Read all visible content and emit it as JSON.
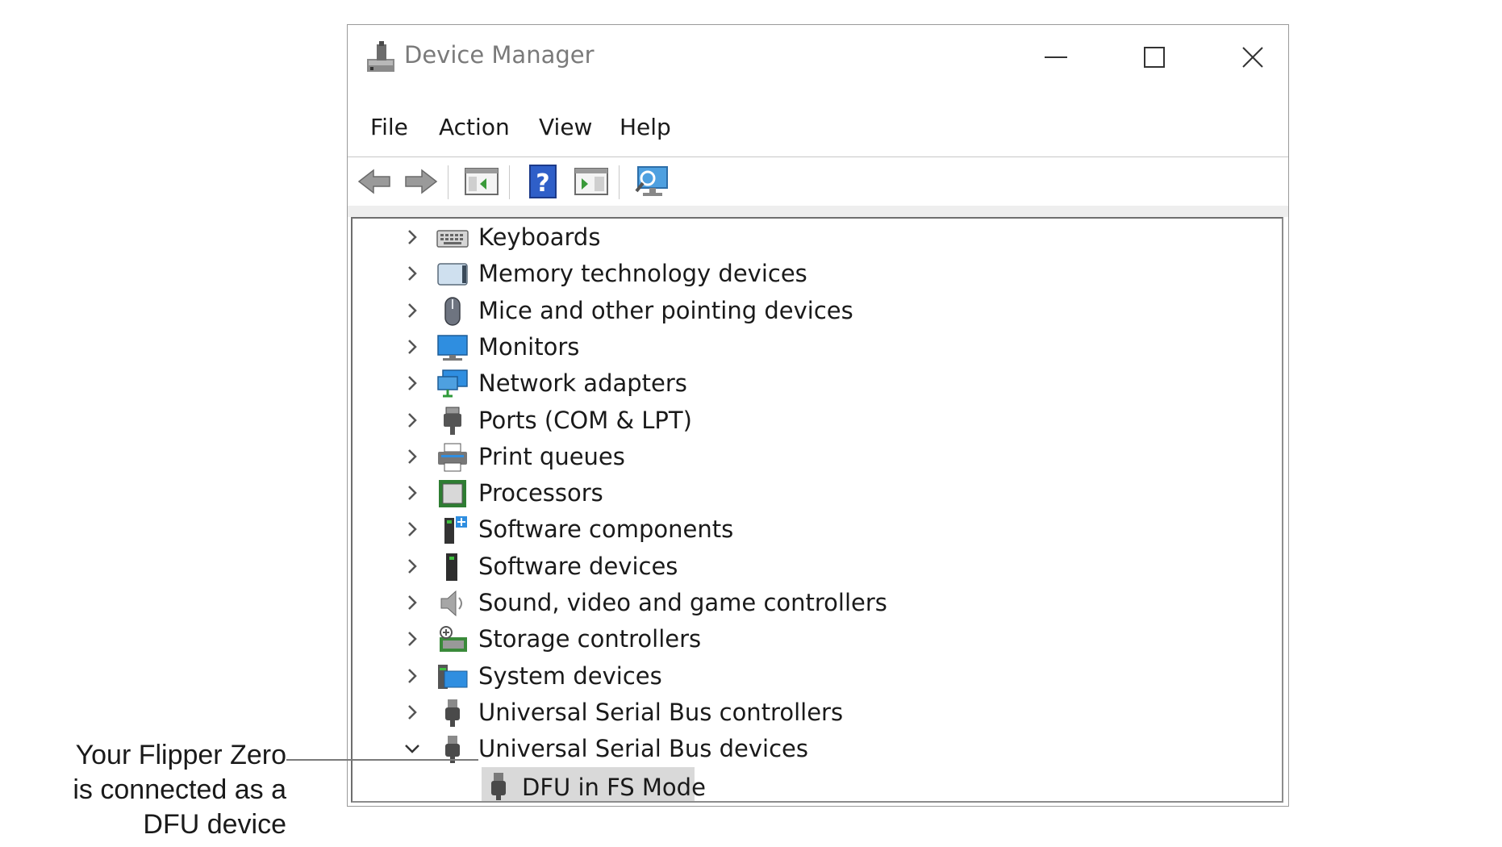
{
  "window": {
    "title": "Device Manager"
  },
  "menu": {
    "file": "File",
    "action": "Action",
    "view": "View",
    "help": "Help"
  },
  "toolbar": {
    "icons": [
      "back-arrow-icon",
      "forward-arrow-icon",
      "show-hide-console-tree-icon",
      "help-icon",
      "properties-pane-icon",
      "scan-hardware-icon"
    ]
  },
  "tree": {
    "categories": [
      {
        "label": "Keyboards",
        "icon": "keyboard-icon",
        "expanded": false
      },
      {
        "label": "Memory technology devices",
        "icon": "memory-device-icon",
        "expanded": false
      },
      {
        "label": "Mice and other pointing devices",
        "icon": "mouse-icon",
        "expanded": false
      },
      {
        "label": "Monitors",
        "icon": "monitor-icon",
        "expanded": false
      },
      {
        "label": "Network adapters",
        "icon": "network-adapter-icon",
        "expanded": false
      },
      {
        "label": "Ports (COM & LPT)",
        "icon": "port-icon",
        "expanded": false
      },
      {
        "label": "Print queues",
        "icon": "printer-icon",
        "expanded": false
      },
      {
        "label": "Processors",
        "icon": "processor-icon",
        "expanded": false
      },
      {
        "label": "Software components",
        "icon": "software-component-icon",
        "expanded": false
      },
      {
        "label": "Software devices",
        "icon": "software-device-icon",
        "expanded": false
      },
      {
        "label": "Sound, video and game controllers",
        "icon": "speaker-icon",
        "expanded": false
      },
      {
        "label": "Storage controllers",
        "icon": "storage-controller-icon",
        "expanded": false
      },
      {
        "label": "System devices",
        "icon": "system-device-icon",
        "expanded": false
      },
      {
        "label": "Universal Serial Bus controllers",
        "icon": "usb-icon",
        "expanded": false
      },
      {
        "label": "Universal Serial Bus devices",
        "icon": "usb-icon",
        "expanded": true
      }
    ],
    "selected_child": {
      "label": "DFU in FS Mode",
      "icon": "usb-device-icon"
    }
  },
  "annotation": {
    "lines": [
      "Your Flipper Zero",
      "is connected as a",
      "DFU device"
    ]
  },
  "colors": {
    "accent_blue": "#2f7fd8",
    "selection": "#d9d9d9",
    "border": "#8c8c8c"
  }
}
